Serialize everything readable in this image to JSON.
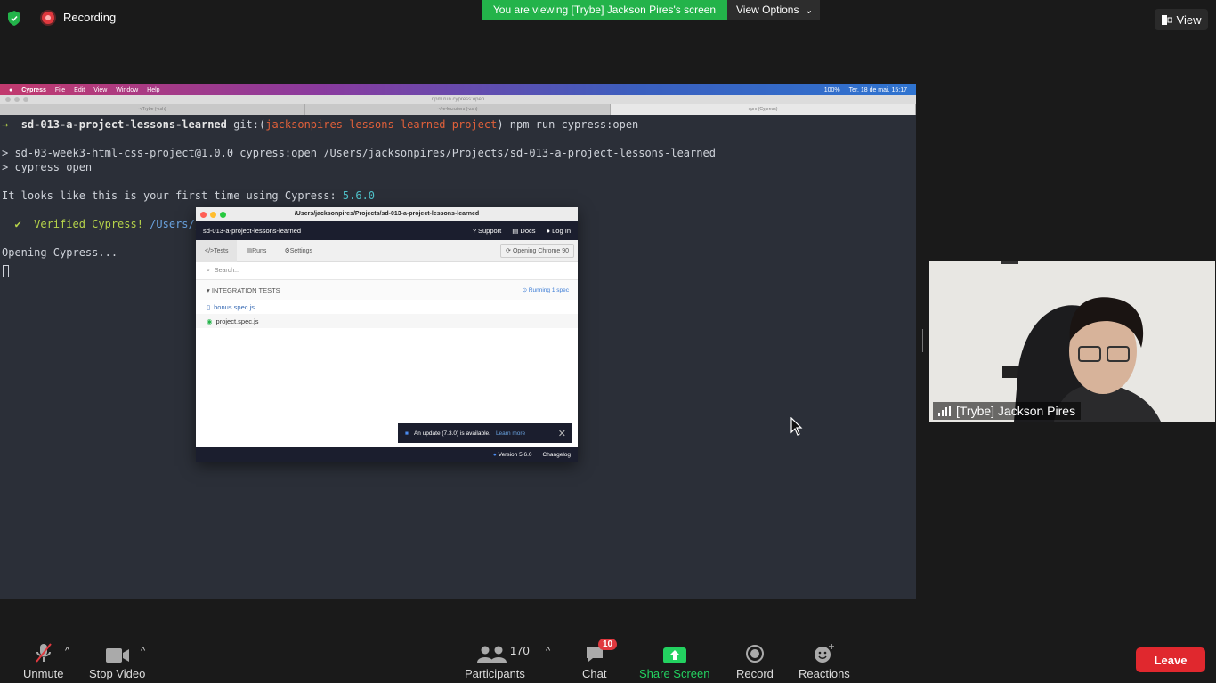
{
  "zoom": {
    "recording_label": "Recording",
    "viewing_banner": "You are viewing [Trybe] Jackson Pires's screen",
    "view_options": "View Options",
    "view_button": "View",
    "participant_name": "[Trybe] Jackson Pires",
    "toolbar": {
      "unmute": "Unmute",
      "stop_video": "Stop Video",
      "participants": "Participants",
      "participants_count": "170",
      "chat": "Chat",
      "chat_badge": "10",
      "share_screen": "Share Screen",
      "record": "Record",
      "reactions": "Reactions",
      "leave": "Leave"
    },
    "colors": {
      "share_green": "#23d160",
      "leave_red": "#e0282e",
      "banner_green": "#23b34a"
    }
  },
  "mac": {
    "menu": [
      "Cypress",
      "File",
      "Edit",
      "View",
      "Window",
      "Help"
    ],
    "status": [
      "100%",
      "Ter. 18 de mai. 15:17"
    ],
    "terminal_title": "npm run cypress:open",
    "tabs": [
      "~/Trybe (-zsh)",
      "~/re-lecruiters (-zsh)",
      "npm (Cypress)"
    ]
  },
  "terminal": {
    "line1_prompt": "→",
    "line1_dir": "sd-013-a-project-lessons-learned",
    "line1_git": " git:(",
    "line1_branch": "jacksonpires-lessons-learned-project",
    "line1_cmd": ") npm run cypress:open",
    "line2": "> sd-03-week3-html-css-project@1.0.0 cypress:open /Users/jacksonpires/Projects/sd-013-a-project-lessons-learned",
    "line3": "> cypress open",
    "line4a": "It looks like this is your first time using Cypress: ",
    "line4b": "5.6.0",
    "line5a": "  ✔  Verified Cypress! ",
    "line5b": "/Users/j",
    "line6": "Opening Cypress..."
  },
  "cypress": {
    "window_title": "/Users/jacksonpires/Projects/sd-013-a-project-lessons-learned",
    "project": "sd-013-a-project-lessons-learned",
    "nav": [
      "Support",
      "Docs",
      "Log In"
    ],
    "tabs": [
      "Tests",
      "Runs",
      "Settings"
    ],
    "chrome_status": "Opening Chrome 90",
    "search_placeholder": "Search...",
    "section": "INTEGRATION TESTS",
    "running": "Running 1 spec",
    "files": [
      "bonus.spec.js",
      "project.spec.js"
    ],
    "update_text": "An update (7.3.0) is available.",
    "learn_more": "Learn more",
    "version": "Version 5.6.0",
    "changelog": "Changelog"
  }
}
